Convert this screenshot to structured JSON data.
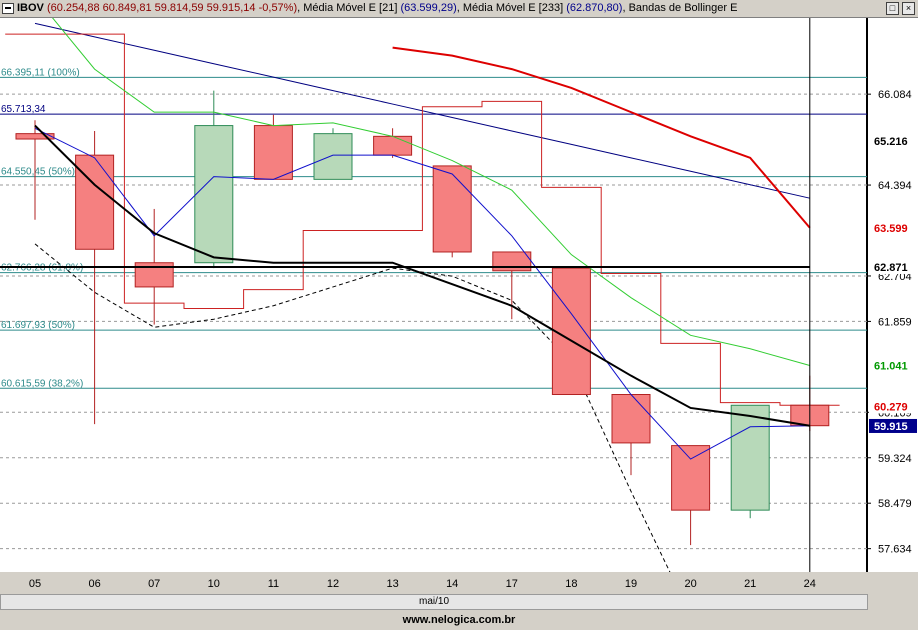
{
  "window": {
    "name": "IBOV",
    "ohlc": "(60.254,88  60.849,81  59.814,59  59.915,14  -0,57%)",
    "ind1_label": ", Média Móvel E [21]",
    "ind1_value": "(63.599,29)",
    "ind2_label": ", Média Móvel E [233]",
    "ind2_value": "(62.870,80)",
    "ind3_label": ", Bandas de Bollinger E",
    "btn_restore": "□",
    "btn_close": "×"
  },
  "footer": {
    "site": "www.nelogica.com.br"
  },
  "scrollbar": {
    "label": "mai/10"
  },
  "colors": {
    "background": "#ffffff",
    "candle_up": "#b7d9b9",
    "candle_down": "#f58080",
    "ma21": "#dd0000",
    "ma233": "#00008b",
    "bollinger_upper": "#000080",
    "bollinger_lower": "#000000",
    "fib_line": "#2e8b8b",
    "green_ma": "#32cd32",
    "black_ma": "#000000"
  },
  "chart_data": {
    "type": "candlestick",
    "categories": [
      "05",
      "06",
      "07",
      "10",
      "11",
      "12",
      "13",
      "14",
      "17",
      "18",
      "19",
      "20",
      "21",
      "24"
    ],
    "candles": [
      {
        "open": 65.35,
        "high": 65.6,
        "low": 63.75,
        "close": 65.25
      },
      {
        "open": 64.95,
        "high": 65.4,
        "low": 59.95,
        "close": 63.2
      },
      {
        "open": 62.95,
        "high": 63.95,
        "low": 61.8,
        "close": 62.5
      },
      {
        "open": 62.95,
        "high": 66.15,
        "low": 62.85,
        "close": 65.5
      },
      {
        "open": 65.5,
        "high": 65.7,
        "low": 64.5,
        "close": 64.5
      },
      {
        "open": 64.5,
        "high": 65.45,
        "low": 64.5,
        "close": 65.35
      },
      {
        "open": 65.3,
        "high": 65.45,
        "low": 64.9,
        "close": 64.95
      },
      {
        "open": 64.75,
        "high": 64.75,
        "low": 63.05,
        "close": 63.15
      },
      {
        "open": 63.15,
        "high": 63.15,
        "low": 61.9,
        "close": 62.8
      },
      {
        "open": 62.85,
        "high": 62.85,
        "low": 60.5,
        "close": 60.5
      },
      {
        "open": 60.5,
        "high": 60.5,
        "low": 59.0,
        "close": 59.6
      },
      {
        "open": 59.55,
        "high": 59.55,
        "low": 57.7,
        "close": 58.35
      },
      {
        "open": 58.35,
        "high": 60.3,
        "low": 58.2,
        "close": 60.3
      },
      {
        "open": 60.3,
        "high": 60.85,
        "low": 59.82,
        "close": 59.92
      }
    ],
    "series": [
      {
        "name": "Média Móvel E [21]",
        "values": [
          null,
          null,
          null,
          null,
          null,
          null,
          66.95,
          66.8,
          66.55,
          66.2,
          65.75,
          65.3,
          64.9,
          63.6
        ]
      },
      {
        "name": "Média Móvel E [233]",
        "values": [
          null,
          null,
          null,
          null,
          null,
          null,
          null,
          null,
          null,
          null,
          null,
          null,
          null,
          62.87
        ]
      },
      {
        "name": "blue_fast",
        "values": [
          65.45,
          64.9,
          63.45,
          64.55,
          64.5,
          64.95,
          64.95,
          64.6,
          63.45,
          62.0,
          60.5,
          59.3,
          59.9,
          59.92
        ]
      },
      {
        "name": "black_mid",
        "values": [
          65.5,
          64.4,
          63.5,
          63.05,
          62.95,
          62.95,
          62.95,
          62.55,
          62.15,
          61.5,
          60.85,
          60.25,
          60.1,
          59.92
        ]
      },
      {
        "name": "green_ma",
        "values": [
          67.9,
          66.55,
          65.75,
          65.75,
          65.5,
          65.55,
          65.3,
          64.85,
          64.3,
          63.1,
          62.3,
          61.6,
          61.35,
          61.04
        ]
      },
      {
        "name": "bollinger_upper",
        "values": [
          67.4,
          67.15,
          66.9,
          66.65,
          66.4,
          66.15,
          65.9,
          65.65,
          65.4,
          65.15,
          64.9,
          64.65,
          64.4,
          64.15
        ]
      },
      {
        "name": "bollinger_lower",
        "values": [
          63.3,
          62.4,
          61.75,
          61.9,
          62.15,
          62.5,
          62.85,
          62.7,
          62.25,
          61.1,
          58.7,
          56.4,
          56.1,
          55.7
        ]
      }
    ],
    "step_line": {
      "values": [
        67.2,
        67.2,
        62.2,
        62.1,
        62.45,
        63.55,
        63.55,
        65.85,
        65.95,
        64.35,
        62.75,
        61.45,
        60.35,
        60.3
      ]
    },
    "fib_levels": [
      {
        "label": "66.395,11 (100%)",
        "value": 66.395
      },
      {
        "label": "65.713,34",
        "value": 65.713
      },
      {
        "label": "64.550,45 (50%)",
        "value": 64.55
      },
      {
        "label": "62.766,28 (61,8%)",
        "value": 62.766
      },
      {
        "label": "61.697,93 (50%)",
        "value": 61.698
      },
      {
        "label": "60.615,59 (38,2%)",
        "value": 60.616
      }
    ],
    "ylim": [
      57.2,
      67.5
    ],
    "y_ticks": [
      {
        "label": "66.084",
        "value": 66.084
      },
      {
        "label": "64.394",
        "value": 64.394
      },
      {
        "label": "62.704",
        "value": 62.704
      },
      {
        "label": "61.859",
        "value": 61.859
      },
      {
        "label": "60.169",
        "value": 60.169
      },
      {
        "label": "59.324",
        "value": 59.324
      },
      {
        "label": "58.479",
        "value": 58.479
      },
      {
        "label": "57.634",
        "value": 57.634
      }
    ],
    "y_tags": [
      {
        "label": "65.216",
        "value": 65.216,
        "bg": "#ffffff",
        "fg": "#000000"
      },
      {
        "label": "63.599",
        "value": 63.599,
        "bg": "#ffffff",
        "fg": "#dd0000"
      },
      {
        "label": "62.871",
        "value": 62.871,
        "bg": "#ffffff",
        "fg": "#000000"
      },
      {
        "label": "61.041",
        "value": 61.041,
        "bg": "#ffffff",
        "fg": "#009900"
      },
      {
        "label": "60.279",
        "value": 60.279,
        "bg": "#ffffff",
        "fg": "#dd0000"
      },
      {
        "label": "59.915",
        "value": 59.915,
        "bg": "#00008b",
        "fg": "#ffffff"
      }
    ],
    "xlabel": "mai/10",
    "grid": true
  }
}
